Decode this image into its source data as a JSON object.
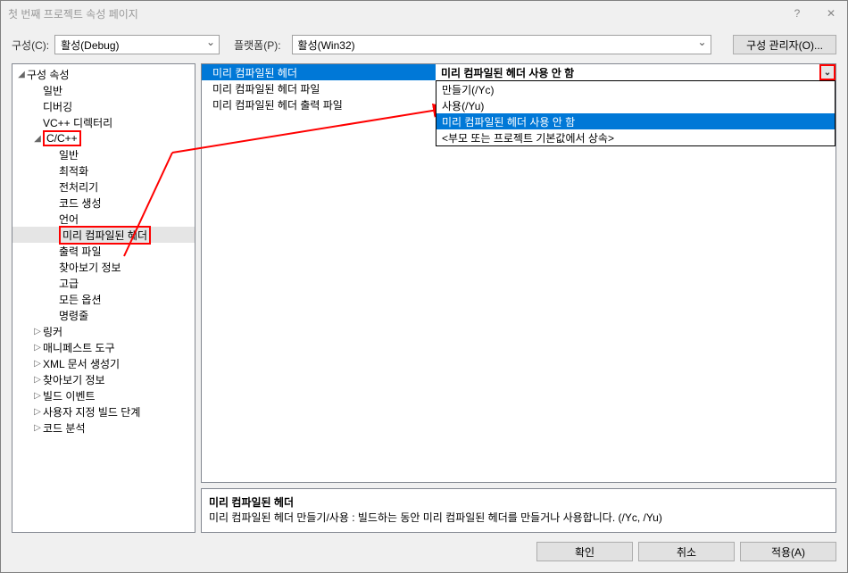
{
  "window_title": "첫 번째 프로젝트 속성 페이지",
  "toolbar": {
    "config_label": "구성(C):",
    "config_value": "활성(Debug)",
    "platform_label": "플랫폼(P):",
    "platform_value": "활성(Win32)",
    "manager_button": "구성 관리자(O)..."
  },
  "tree": {
    "root": "구성 속성",
    "items": [
      {
        "label": "일반",
        "indent": 1
      },
      {
        "label": "디버깅",
        "indent": 1
      },
      {
        "label": "VC++ 디렉터리",
        "indent": 1
      },
      {
        "label": "C/C++",
        "indent": 1,
        "expandable": true,
        "expanded": true,
        "redbox": true
      },
      {
        "label": "일반",
        "indent": 2
      },
      {
        "label": "최적화",
        "indent": 2
      },
      {
        "label": "전처리기",
        "indent": 2
      },
      {
        "label": "코드 생성",
        "indent": 2
      },
      {
        "label": "언어",
        "indent": 2
      },
      {
        "label": "미리 컴파일된 헤더",
        "indent": 2,
        "selected": true,
        "redbox": true
      },
      {
        "label": "출력 파일",
        "indent": 2
      },
      {
        "label": "찾아보기 정보",
        "indent": 2
      },
      {
        "label": "고급",
        "indent": 2
      },
      {
        "label": "모든 옵션",
        "indent": 2
      },
      {
        "label": "명령줄",
        "indent": 2
      },
      {
        "label": "링커",
        "indent": 1,
        "expandable": true
      },
      {
        "label": "매니페스트 도구",
        "indent": 1,
        "expandable": true
      },
      {
        "label": "XML 문서 생성기",
        "indent": 1,
        "expandable": true
      },
      {
        "label": "찾아보기 정보",
        "indent": 1,
        "expandable": true
      },
      {
        "label": "빌드 이벤트",
        "indent": 1,
        "expandable": true
      },
      {
        "label": "사용자 지정 빌드 단계",
        "indent": 1,
        "expandable": true
      },
      {
        "label": "코드 분석",
        "indent": 1,
        "expandable": true
      }
    ]
  },
  "properties": [
    {
      "label": "미리 컴파일된 헤더",
      "value": "미리 컴파일된 헤더 사용 안 함",
      "selected": true
    },
    {
      "label": "미리 컴파일된 헤더 파일",
      "value": ""
    },
    {
      "label": "미리 컴파일된 헤더 출력 파일",
      "value": ""
    }
  ],
  "dropdown": [
    {
      "label": "만들기(/Yc)"
    },
    {
      "label": "사용(/Yu)"
    },
    {
      "label": "미리 컴파일된 헤더 사용 안 함",
      "highlighted": true
    },
    {
      "label": "<부모 또는 프로젝트 기본값에서 상속>"
    }
  ],
  "description": {
    "title": "미리 컴파일된 헤더",
    "text": "미리 컴파일된 헤더 만들기/사용 : 빌드하는 동안 미리 컴파일된 헤더를 만들거나 사용합니다.     (/Yc, /Yu)"
  },
  "footer": {
    "ok": "확인",
    "cancel": "취소",
    "apply": "적용(A)"
  }
}
